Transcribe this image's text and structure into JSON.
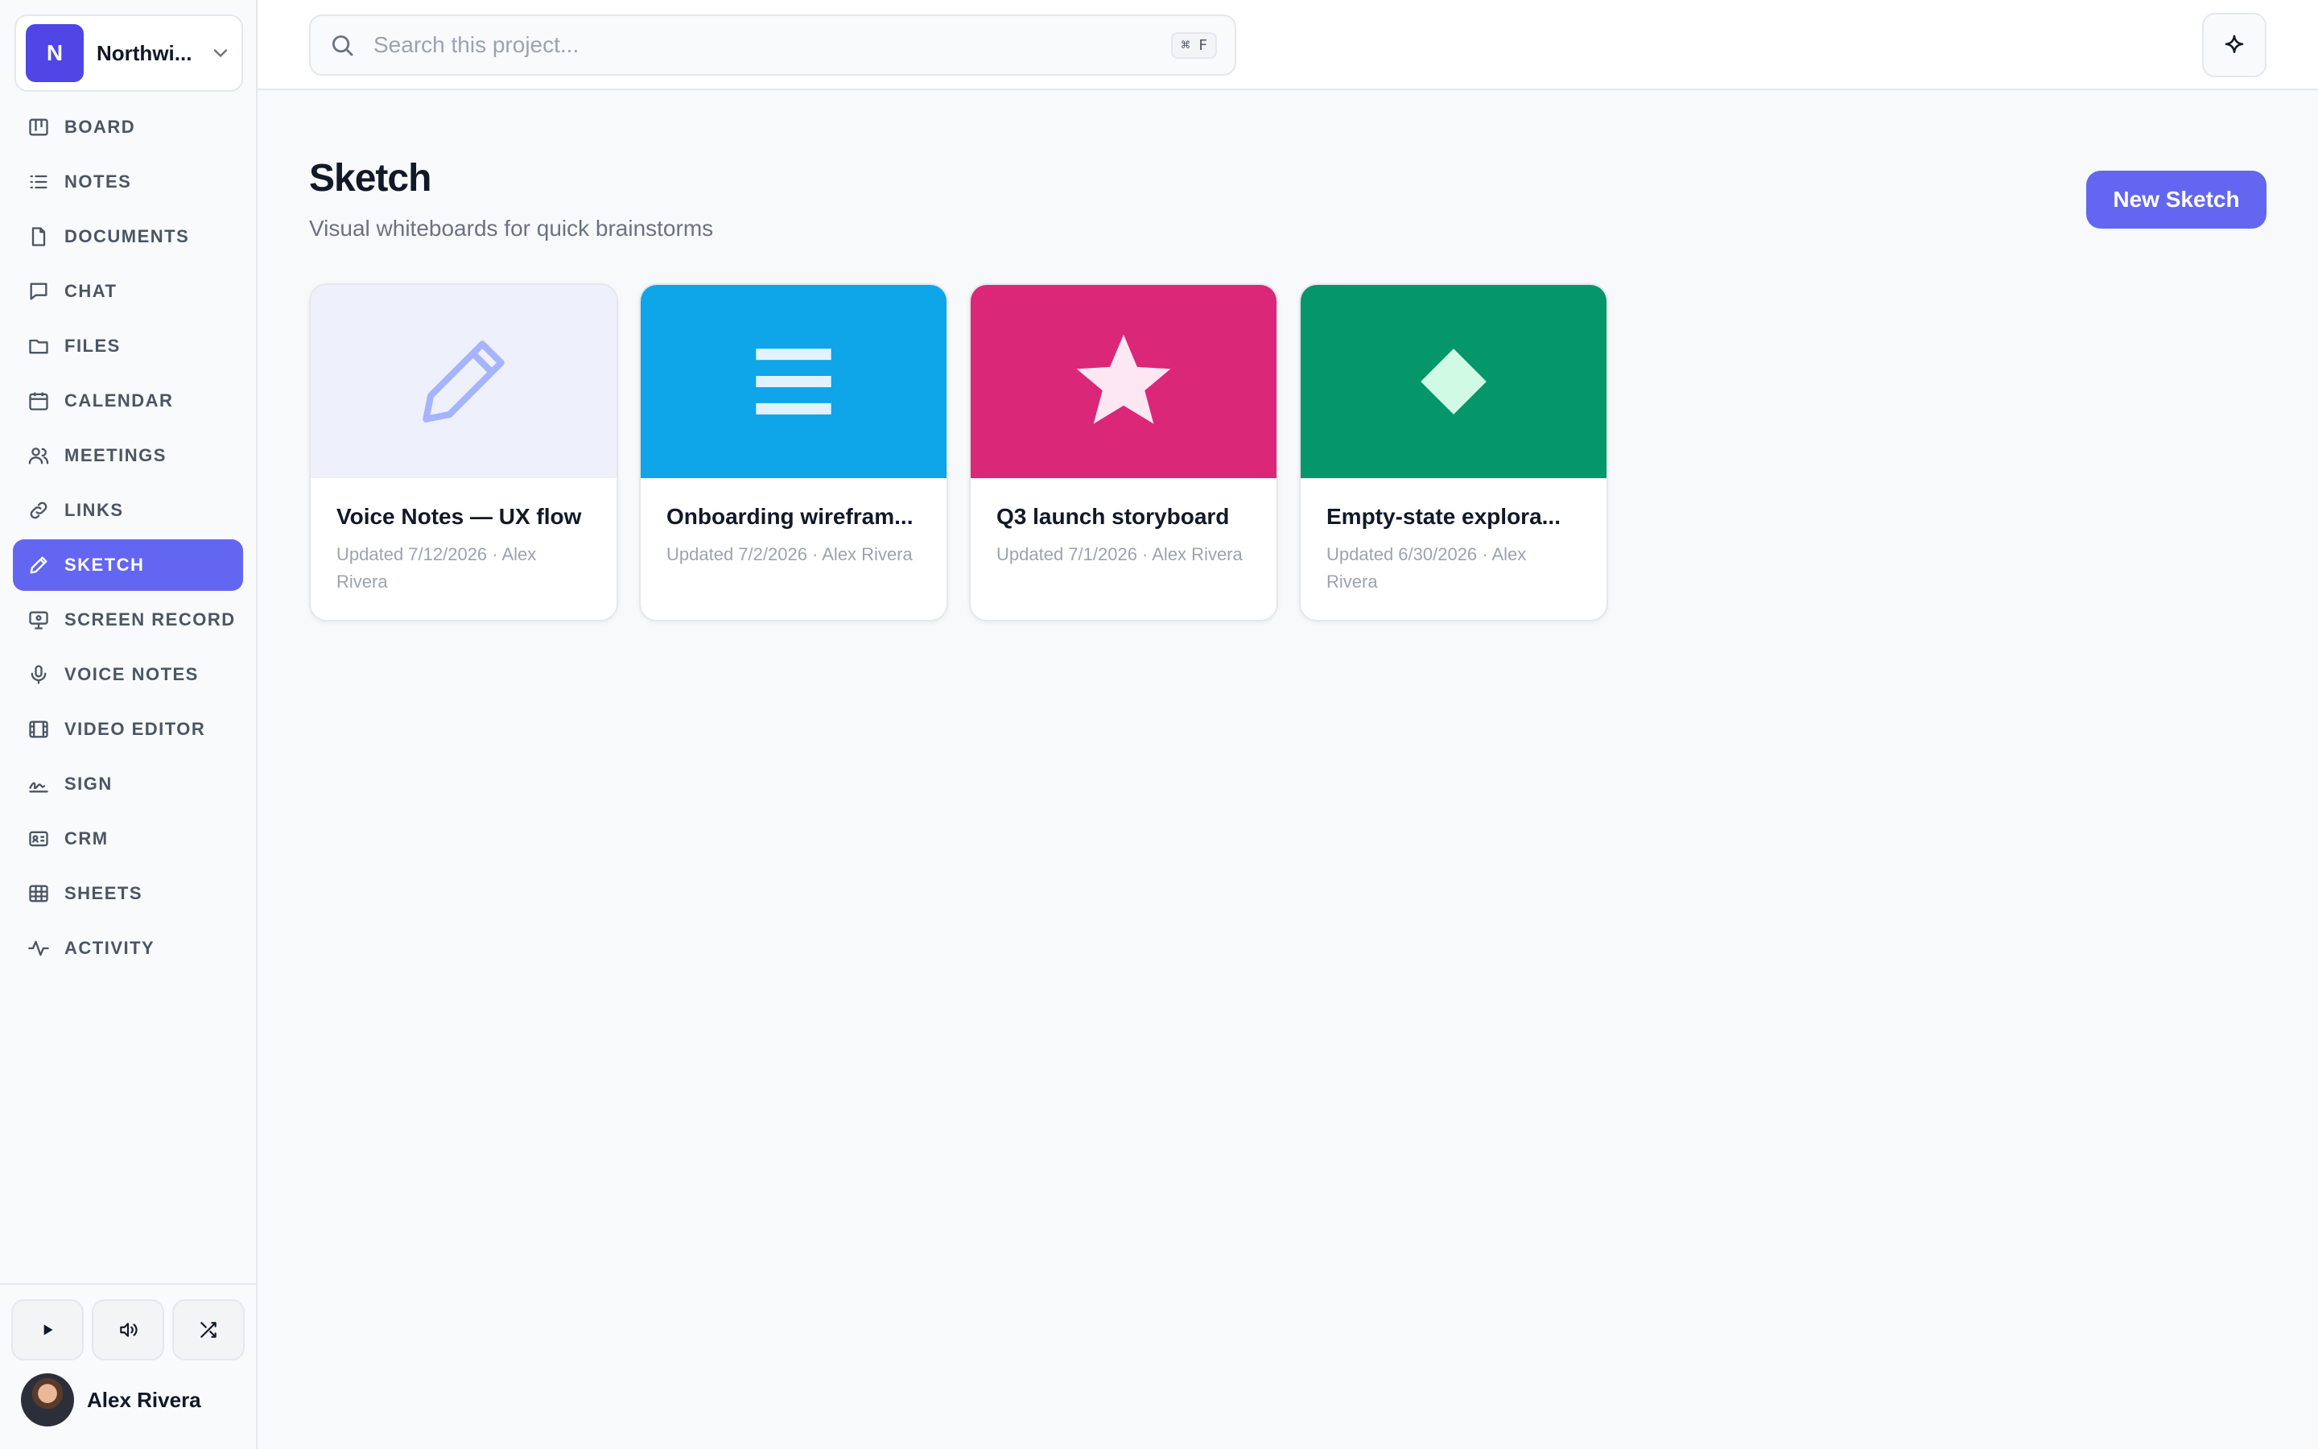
{
  "workspace": {
    "initial": "N",
    "name": "Northwi..."
  },
  "sidebar": {
    "items": [
      {
        "label": "BOARD",
        "icon": "board-icon",
        "active": false
      },
      {
        "label": "NOTES",
        "icon": "notes-icon",
        "active": false
      },
      {
        "label": "DOCUMENTS",
        "icon": "document-icon",
        "active": false
      },
      {
        "label": "CHAT",
        "icon": "chat-icon",
        "active": false
      },
      {
        "label": "FILES",
        "icon": "folder-icon",
        "active": false
      },
      {
        "label": "CALENDAR",
        "icon": "calendar-icon",
        "active": false
      },
      {
        "label": "MEETINGS",
        "icon": "users-icon",
        "active": false
      },
      {
        "label": "LINKS",
        "icon": "link-icon",
        "active": false
      },
      {
        "label": "SKETCH",
        "icon": "pencil-icon",
        "active": true
      },
      {
        "label": "SCREEN RECORD",
        "icon": "monitor-icon",
        "active": false
      },
      {
        "label": "VOICE NOTES",
        "icon": "microphone-icon",
        "active": false
      },
      {
        "label": "VIDEO EDITOR",
        "icon": "film-icon",
        "active": false
      },
      {
        "label": "SIGN",
        "icon": "signature-icon",
        "active": false
      },
      {
        "label": "CRM",
        "icon": "contact-card-icon",
        "active": false
      },
      {
        "label": "SHEETS",
        "icon": "table-icon",
        "active": false
      },
      {
        "label": "ACTIVITY",
        "icon": "activity-icon",
        "active": false
      }
    ]
  },
  "player": {
    "play_icon": "play-icon",
    "volume_icon": "volume-icon",
    "shuffle_icon": "shuffle-icon"
  },
  "user": {
    "name": "Alex Rivera"
  },
  "search": {
    "placeholder": "Search this project...",
    "shortcut": "⌘ F"
  },
  "page": {
    "title": "Sketch",
    "subtitle": "Visual whiteboards for quick brainstorms",
    "new_button": "New Sketch"
  },
  "cards": [
    {
      "title": "Voice Notes — UX flow",
      "meta": "Updated 7/12/2026 · Alex Rivera",
      "color": "#eef0fb",
      "icon": "pencil-icon"
    },
    {
      "title": "Onboarding wirefram...",
      "meta": "Updated 7/2/2026 · Alex Rivera",
      "color": "#0ea5e9",
      "icon": "menu-lines-icon"
    },
    {
      "title": "Q3 launch storyboard",
      "meta": "Updated 7/1/2026 · Alex Rivera",
      "color": "#db2777",
      "icon": "star-icon"
    },
    {
      "title": "Empty-state explora...",
      "meta": "Updated 6/30/2026 · Alex Rivera",
      "color": "#059669",
      "icon": "diamond-icon"
    }
  ],
  "colors": {
    "accent": "#6366f1",
    "workspace": "#4f46e5"
  }
}
